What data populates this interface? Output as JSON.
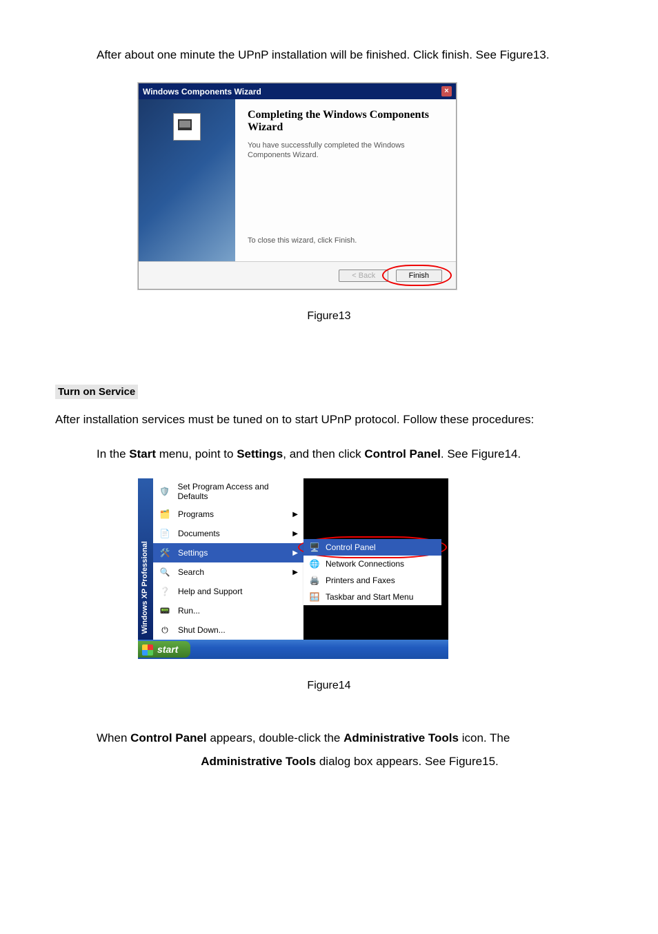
{
  "intro": "After about one minute the UPnP installation will be finished. Click finish. See Figure13.",
  "wizard": {
    "titlebar": "Windows Components Wizard",
    "heading": "Completing the Windows Components Wizard",
    "sub": "You have successfully completed the Windows Components Wizard.",
    "closehint": "To close this wizard, click Finish.",
    "back": "< Back",
    "finish": "Finish"
  },
  "caption13": "Figure13",
  "subhead": "Turn on Service",
  "after_install": "After installation services must be tuned on to start UPnP protocol. Follow these procedures:",
  "step1": {
    "prefix": "In the ",
    "start_b": "Start",
    "mid1": " menu, point to ",
    "settings_b": "Settings",
    "mid2": ", and then click ",
    "cp_b": "Control Panel",
    "suffix": ". See Figure14."
  },
  "startmenu": {
    "os_label": "Windows XP Professional",
    "items": {
      "defaults": "Set Program Access and Defaults",
      "programs": "Programs",
      "documents": "Documents",
      "settings": "Settings",
      "search": "Search",
      "help": "Help and Support",
      "run": "Run...",
      "shutdown": "Shut Down..."
    },
    "settings_sub": {
      "control_panel": "Control Panel",
      "network": "Network Connections",
      "printers": "Printers and Faxes",
      "taskbar": "Taskbar and Start Menu"
    },
    "start": "start"
  },
  "caption14": "Figure14",
  "step2": {
    "l1a": "When ",
    "l1b": "Control Panel",
    "l1c": " appears, double-click the ",
    "l1d": "Administrative Tools",
    "l1e": " icon. The",
    "l2a": "Administrative Tools",
    "l2b": " dialog box appears. See Figure15."
  }
}
